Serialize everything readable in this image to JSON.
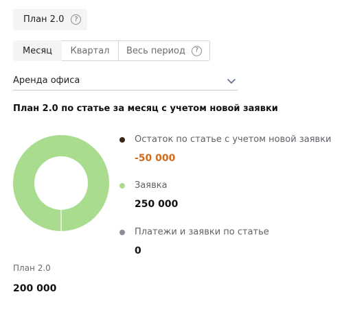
{
  "plan_chip": {
    "label": "План 2.0",
    "help_glyph": "?"
  },
  "tabs": [
    {
      "label": "Месяц",
      "active": true
    },
    {
      "label": "Квартал",
      "active": false
    },
    {
      "label": "Весь период",
      "active": false,
      "help_glyph": "?"
    }
  ],
  "article_select": {
    "value": "Аренда офиса"
  },
  "section": {
    "title": "План 2.0 по статье за месяц с учетом новой заявки"
  },
  "chart_data": {
    "type": "pie",
    "labels": [
      "Остаток по статье с учетом новой заявки",
      "Заявка",
      "Платежи и заявки по статье"
    ],
    "values": [
      -50000,
      250000,
      0
    ],
    "display_values": [
      "-50 000",
      "250 000",
      "0"
    ],
    "colors": [
      "#3d2416",
      "#a9dc8e",
      "#8a8d99"
    ],
    "total_label": "План 2.0",
    "total_display": "200 000"
  },
  "colors": {
    "accent_negative": "#d46a1b",
    "donut_fill": "#a9dc8e",
    "chip_bg": "#f3f4f6"
  },
  "icons": {
    "help": "help-circle-icon",
    "chevron": "chevron-down-icon"
  }
}
